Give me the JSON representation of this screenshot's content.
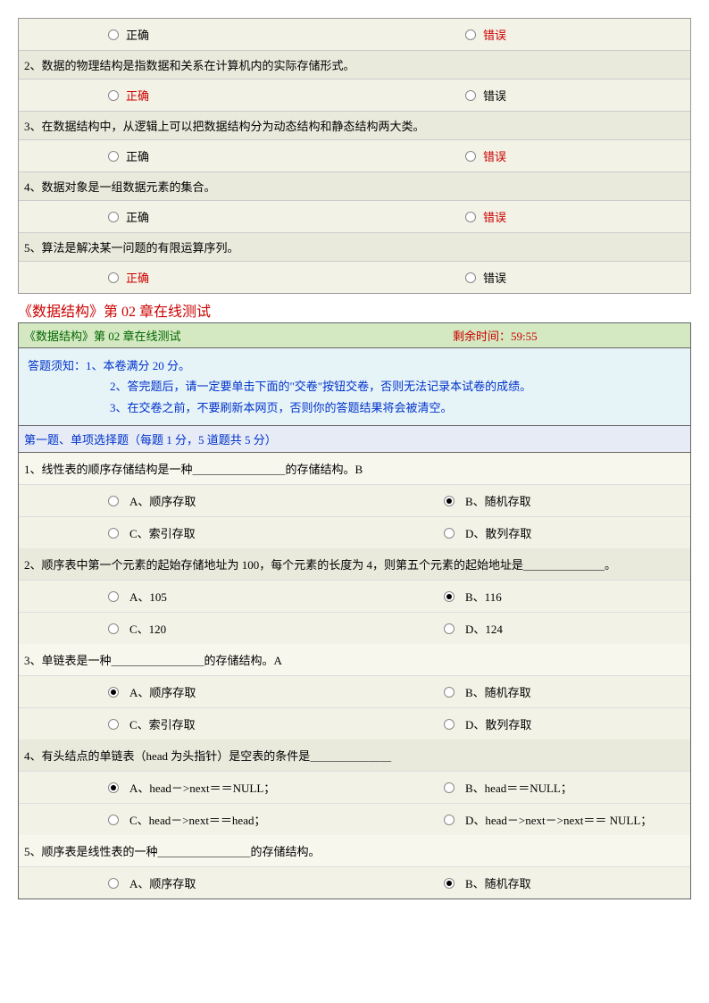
{
  "tf": {
    "rows": [
      {
        "q": "",
        "true_label": "正确",
        "false_label": "错误",
        "true_red": false,
        "false_red": true,
        "show_q": false
      },
      {
        "q": "2、数据的物理结构是指数据和关系在计算机内的实际存储形式。",
        "true_label": "正确",
        "false_label": "错误",
        "true_red": true,
        "false_red": false,
        "show_q": true
      },
      {
        "q": "3、在数据结构中，从逻辑上可以把数据结构分为动态结构和静态结构两大类。",
        "true_label": "正确",
        "false_label": "错误",
        "true_red": false,
        "false_red": true,
        "show_q": true
      },
      {
        "q": "4、数据对象是一组数据元素的集合。",
        "true_label": "正确",
        "false_label": "错误",
        "true_red": false,
        "false_red": true,
        "show_q": true
      },
      {
        "q": "5、算法是解决某一问题的有限运算序列。",
        "true_label": "正确",
        "false_label": "错误",
        "true_red": true,
        "false_red": false,
        "show_q": true
      }
    ]
  },
  "page_title": "《数据结构》第 02 章在线测试",
  "header": {
    "left": "《数据结构》第 02 章在线测试",
    "right": "剩余时间：59:55"
  },
  "instructions": {
    "line1": "答题须知：1、本卷满分 20 分。",
    "line2": "2、答完题后，请一定要单击下面的\"交卷\"按钮交卷，否则无法记录本试卷的成绩。",
    "line3": "3、在交卷之前，不要刷新本网页，否则你的答题结果将会被清空。"
  },
  "section_header": "第一题、单项选择题（每题 1 分，5 道题共 5 分）",
  "mc": [
    {
      "q": "1、线性表的顺序存储结构是一种＿＿＿＿＿＿＿＿的存储结构。B",
      "opts": [
        {
          "t": "A、顺序存取",
          "sel": false
        },
        {
          "t": "B、随机存取",
          "sel": true
        },
        {
          "t": "C、索引存取",
          "sel": false
        },
        {
          "t": "D、散列存取",
          "sel": false
        }
      ]
    },
    {
      "q": "2、顺序表中第一个元素的起始存储地址为 100，每个元素的长度为 4，则第五个元素的起始地址是＿＿＿＿＿＿＿。",
      "opts": [
        {
          "t": "A、105",
          "sel": false
        },
        {
          "t": "B、116",
          "sel": true
        },
        {
          "t": "C、120",
          "sel": false
        },
        {
          "t": "D、124",
          "sel": false
        }
      ]
    },
    {
      "q": "3、单链表是一种＿＿＿＿＿＿＿＿的存储结构。A",
      "opts": [
        {
          "t": "A、顺序存取",
          "sel": true
        },
        {
          "t": "B、随机存取",
          "sel": false
        },
        {
          "t": "C、索引存取",
          "sel": false
        },
        {
          "t": "D、散列存取",
          "sel": false
        }
      ]
    },
    {
      "q": "4、有头结点的单链表（head 为头指针）是空表的条件是＿＿＿＿＿＿＿",
      "opts": [
        {
          "t": "A、head－>next＝＝NULL；",
          "sel": true
        },
        {
          "t": "B、head＝＝NULL；",
          "sel": false
        },
        {
          "t": "C、head－>next＝＝head；",
          "sel": false
        },
        {
          "t": "D、head－>next－>next＝＝ NULL；",
          "sel": false
        }
      ]
    },
    {
      "q": "5、顺序表是线性表的一种＿＿＿＿＿＿＿＿的存储结构。",
      "opts": [
        {
          "t": "A、顺序存取",
          "sel": false
        },
        {
          "t": "B、随机存取",
          "sel": true
        }
      ]
    }
  ]
}
